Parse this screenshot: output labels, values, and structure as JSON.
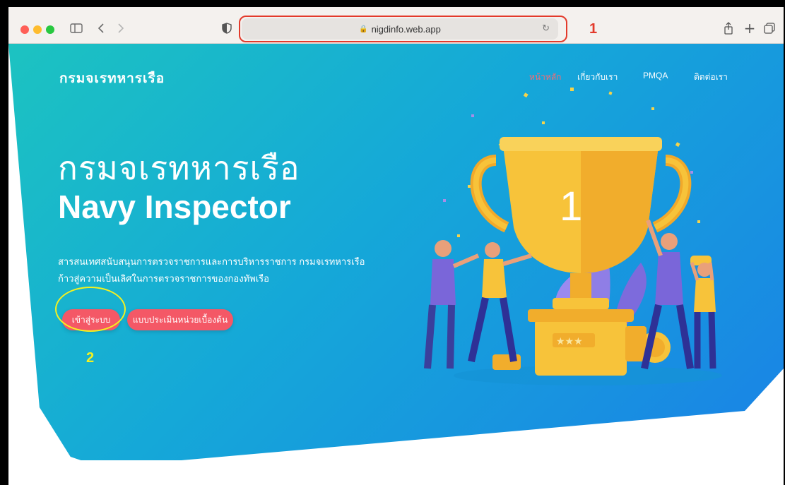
{
  "browser": {
    "url": "nigdinfo.web.app"
  },
  "annotations": {
    "label_1": "1",
    "label_2": "2"
  },
  "site": {
    "brand": "กรมจเรทหารเรือ",
    "nav": [
      {
        "label": "หน้าหลัก",
        "active": true
      },
      {
        "label": "เกี่ยวกับเรา",
        "active": false
      },
      {
        "label": "PMQA",
        "active": false
      },
      {
        "label": "ติดต่อเรา",
        "active": false
      }
    ]
  },
  "hero": {
    "title": "กรมจเรทหารเรือ",
    "subtitle": "Navy Inspector",
    "desc_line1": "สารสนเทศสนับสนุนการตรวจราชการและการบริหารราชการ กรมจเรทหารเรือ",
    "desc_line2": "ก้าวสู่ความเป็นเลิศในการตรวจราชการของกองทัพเรือ",
    "login_button": "เข้าสู่ระบบ",
    "assessment_button": "แบบประเมินหน่วยเบื้องต้น",
    "trophy_number": "1"
  },
  "colors": {
    "accent": "#f45866",
    "gradient_start": "#1cc3c1",
    "gradient_end": "#1a82e6",
    "annotation_red": "#e33a2b",
    "annotation_yellow": "#f5f11f"
  }
}
